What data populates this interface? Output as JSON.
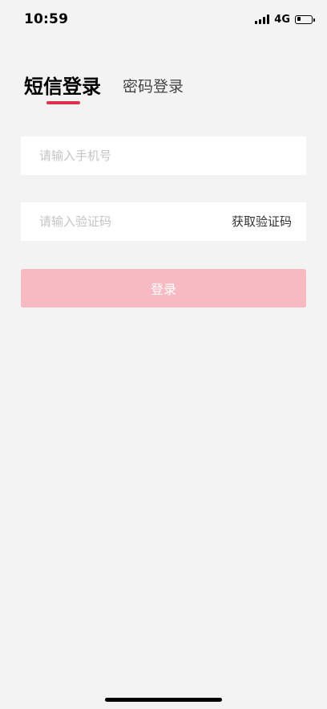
{
  "status_bar": {
    "time": "10:59",
    "network": "4G",
    "battery_level": 0.25,
    "icons": [
      "signal-icon",
      "battery-icon"
    ]
  },
  "tabs": [
    {
      "label": "短信登录",
      "active": true
    },
    {
      "label": "密码登录",
      "active": false
    }
  ],
  "phone_field": {
    "value": "",
    "placeholder": "请输入手机号"
  },
  "code_field": {
    "value": "",
    "placeholder": "请输入验证码",
    "get_code_label": "获取验证码"
  },
  "login_button": {
    "label": "登录"
  },
  "colors": {
    "accent": "#e0314a",
    "button_disabled": "#f7b9c2",
    "background": "#f3f3f3",
    "placeholder": "#c4c4c4"
  }
}
